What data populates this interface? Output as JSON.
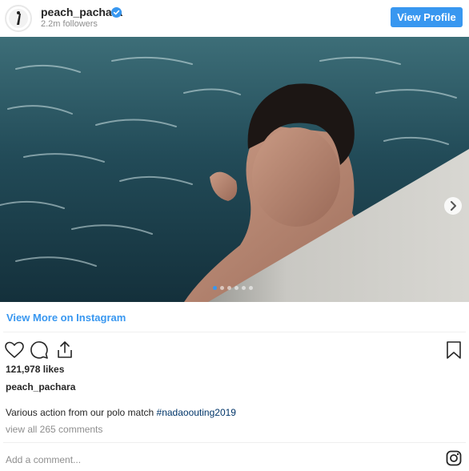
{
  "header": {
    "username": "peach_pachara",
    "followers": "2.2m followers",
    "view_profile_label": "View Profile"
  },
  "post": {
    "carousel": {
      "total_slides": 6,
      "active_slide": 1
    },
    "view_more_label": "View More on Instagram",
    "likes": "121,978 likes",
    "caption_username": "peach_pachara",
    "caption_text": "Various action from our polo match ",
    "caption_hashtag": "#nadaoouting2019",
    "view_comments": "view all 265 comments",
    "add_comment_placeholder": "Add a comment..."
  },
  "colors": {
    "accent": "#3897f0",
    "hashtag": "#003569",
    "muted": "#8e8e8e",
    "text": "#262626"
  },
  "icons": [
    "verified-badge-icon",
    "chevron-right-icon",
    "heart-icon",
    "comment-icon",
    "share-icon",
    "bookmark-icon",
    "instagram-icon"
  ]
}
